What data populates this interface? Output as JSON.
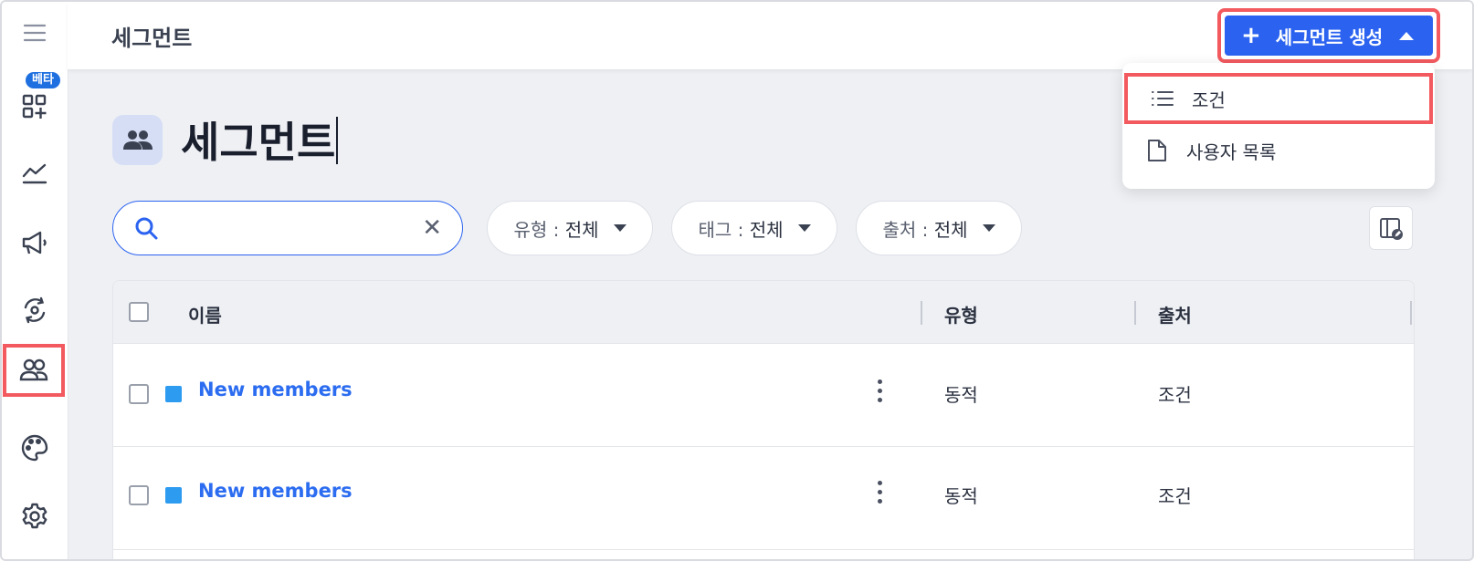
{
  "header": {
    "title": "세그먼트",
    "create_label": "세그먼트 생성"
  },
  "sidebar": {
    "beta_badge": "베타",
    "items": [
      {
        "icon": "menu-icon"
      },
      {
        "icon": "dashboard-add-icon"
      },
      {
        "icon": "chart-line-icon"
      },
      {
        "icon": "megaphone-icon"
      },
      {
        "icon": "cycle-icon"
      },
      {
        "icon": "users-icon",
        "active": true
      },
      {
        "icon": "palette-icon"
      },
      {
        "icon": "gear-icon"
      }
    ]
  },
  "page": {
    "title": "세그먼트"
  },
  "search": {
    "placeholder": "",
    "value": ""
  },
  "filters": [
    {
      "key": "유형 :",
      "value": "전체"
    },
    {
      "key": "태그 :",
      "value": "전체"
    },
    {
      "key": "출처 :",
      "value": "전체"
    }
  ],
  "menu": {
    "items": [
      {
        "label": "조건",
        "icon": "list-icon"
      },
      {
        "label": "사용자 목록",
        "icon": "document-icon"
      }
    ]
  },
  "table": {
    "columns": [
      "이름",
      "유형",
      "출처"
    ],
    "rows": [
      {
        "name": "New members",
        "type": "동적",
        "source": "조건",
        "color": "#2d9bf0"
      },
      {
        "name": "New members",
        "type": "동적",
        "source": "조건",
        "color": "#2d9bf0"
      }
    ]
  },
  "colors": {
    "accent": "#2b63f0",
    "highlight": "#f25a5f",
    "link": "#2b6cf0"
  }
}
